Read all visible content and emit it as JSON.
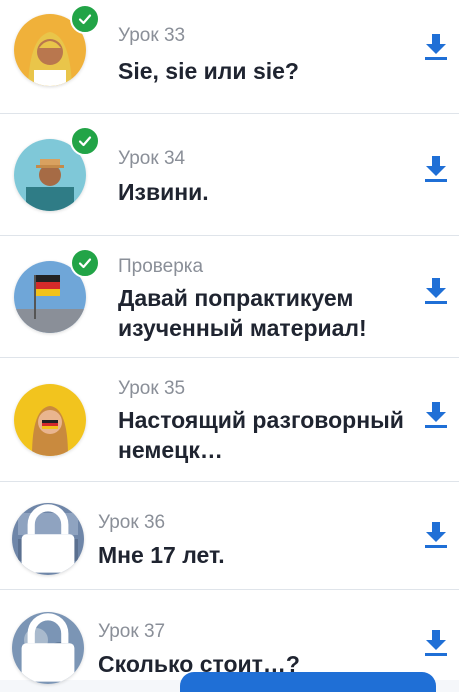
{
  "lessons": [
    {
      "subtitle": "Урок 33",
      "title": "Sie, sie или sie?",
      "status": "completed",
      "avatar_icon": "woman-hijab-photo"
    },
    {
      "subtitle": "Урок 34",
      "title": "Извини.",
      "status": "completed",
      "avatar_icon": "man-hat-photo"
    },
    {
      "subtitle": "Проверка",
      "title": "Давай попрактикуем изученный материал!",
      "status": "completed",
      "avatar_icon": "german-flag-reichstag-photo"
    },
    {
      "subtitle": "Урок 35",
      "title": "Настоящий разговорный немецк…",
      "status": "available",
      "avatar_icon": "woman-german-flag-photo"
    },
    {
      "subtitle": "Урок 36",
      "title": "Мне 17 лет.",
      "status": "locked",
      "avatar_icon": "lock-icon"
    },
    {
      "subtitle": "Урок 37",
      "title": "Сколько стоит…?",
      "status": "locked",
      "avatar_icon": "lock-icon"
    }
  ],
  "colors": {
    "accent": "#1f6fd6",
    "check": "#22a447",
    "title": "#1f2430",
    "subtitle": "#8a8f98"
  }
}
